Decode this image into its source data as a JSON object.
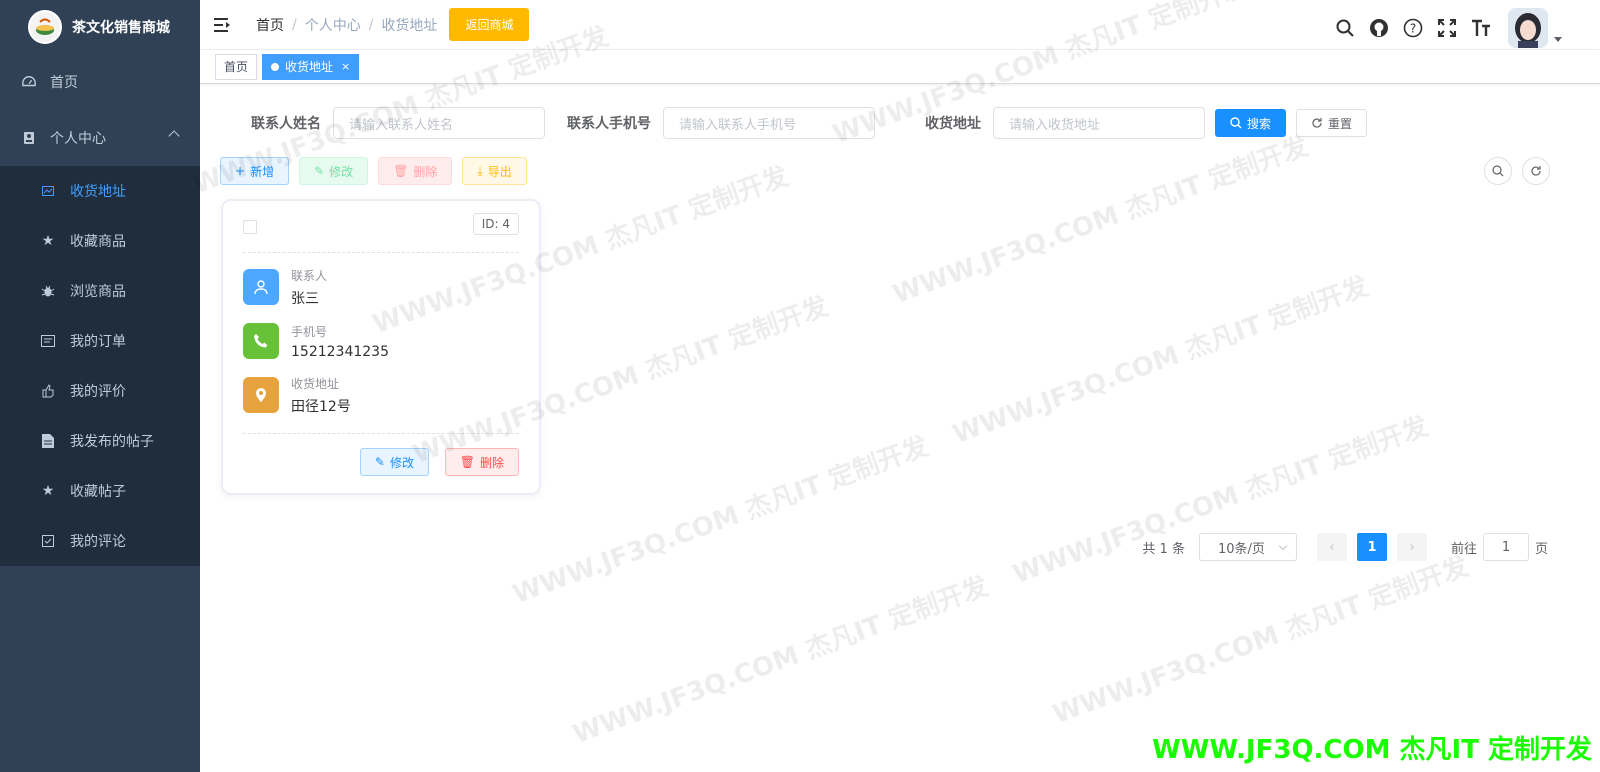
{
  "sidebar": {
    "brand_title": "茶文化销售商城",
    "items": [
      {
        "label": "首页",
        "icon": "dashboard-icon"
      },
      {
        "label": "个人中心",
        "icon": "user-icon"
      }
    ],
    "sub_items": [
      {
        "label": "收货地址",
        "icon": "address-icon",
        "active": true
      },
      {
        "label": "收藏商品",
        "icon": "star-icon"
      },
      {
        "label": "浏览商品",
        "icon": "bug-icon"
      },
      {
        "label": "我的订单",
        "icon": "order-icon"
      },
      {
        "label": "我的评价",
        "icon": "thumb-icon"
      },
      {
        "label": "我发布的帖子",
        "icon": "document-icon"
      },
      {
        "label": "收藏帖子",
        "icon": "star-icon"
      },
      {
        "label": "我的评论",
        "icon": "checkbox-icon"
      }
    ]
  },
  "header": {
    "breadcrumb": [
      "首页",
      "个人中心",
      "收货地址"
    ],
    "back_button": "返回商城"
  },
  "tags": {
    "home": "首页",
    "active": "收货地址",
    "close": "×"
  },
  "search": {
    "contact_label": "联系人姓名",
    "contact_placeholder": "请输入联系人姓名",
    "phone_label": "联系人手机号",
    "phone_placeholder": "请输入联系人手机号",
    "address_label": "收货地址",
    "address_placeholder": "请输入收货地址",
    "search_button": "搜索",
    "reset_button": "重置"
  },
  "toolbar": {
    "add": "新增",
    "edit": "修改",
    "delete": "删除",
    "export": "导出"
  },
  "card": {
    "id_label": "ID: 4",
    "contact_label": "联系人",
    "contact_value": "张三",
    "phone_label": "手机号",
    "phone_value": "15212341235",
    "address_label": "收货地址",
    "address_value": "田径12号",
    "edit_button": "修改",
    "delete_button": "删除"
  },
  "pagination": {
    "total": "共 1 条",
    "page_size": "10条/页",
    "current_page": "1",
    "goto_label": "前往",
    "goto_value": "1",
    "page_suffix": "页"
  },
  "watermark": {
    "text": "WWW.JF3Q.COM 杰凡IT  定制开发",
    "color": "#1aff00"
  },
  "colors": {
    "sidebar_bg": "#304156",
    "submenu_bg": "#1f2d3d",
    "primary": "#1890ff",
    "warning": "#ffba00"
  }
}
